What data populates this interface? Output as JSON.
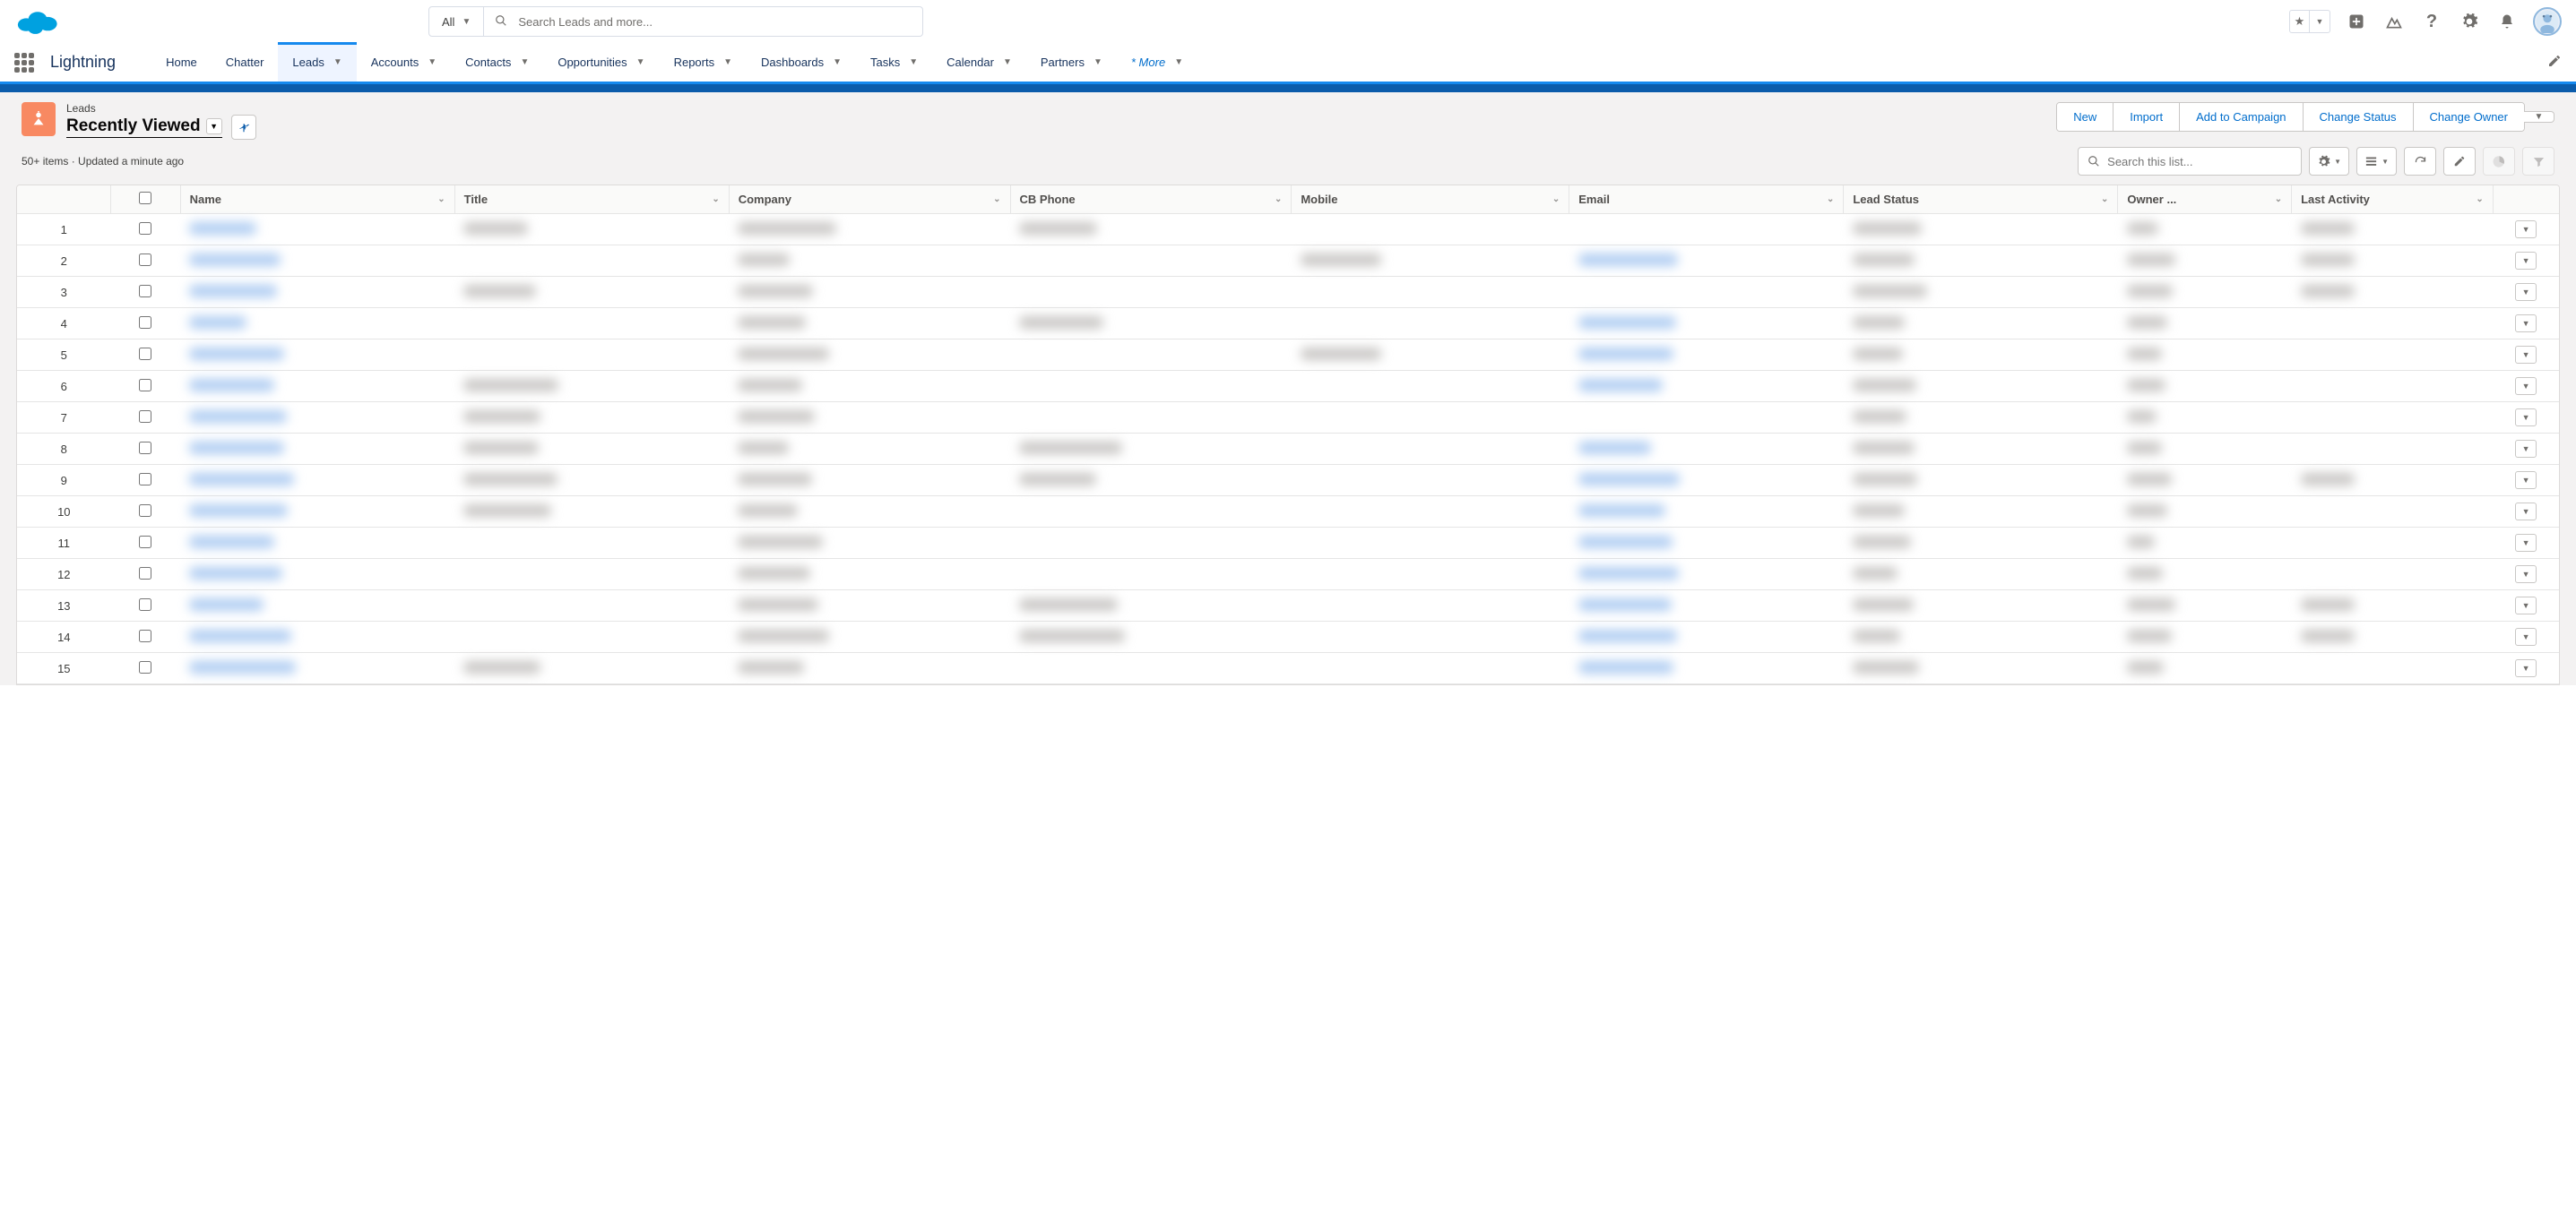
{
  "header": {
    "scope": "All",
    "search_placeholder": "Search Leads and more..."
  },
  "nav": {
    "app_name": "Lightning",
    "tabs": [
      "Home",
      "Chatter",
      "Leads",
      "Accounts",
      "Contacts",
      "Opportunities",
      "Reports",
      "Dashboards",
      "Tasks",
      "Calendar",
      "Partners"
    ],
    "more_label": "* More",
    "active_tab": "Leads"
  },
  "page": {
    "object_label": "Leads",
    "view_name": "Recently Viewed",
    "meta": "50+ items · Updated a minute ago",
    "actions": [
      "New",
      "Import",
      "Add to Campaign",
      "Change Status",
      "Change Owner"
    ],
    "list_search_placeholder": "Search this list..."
  },
  "table": {
    "columns": [
      "Name",
      "Title",
      "Company",
      "CB Phone",
      "Mobile",
      "Email",
      "Lead Status",
      "Owner ...",
      "Last Activity"
    ],
    "row_count": 15
  }
}
